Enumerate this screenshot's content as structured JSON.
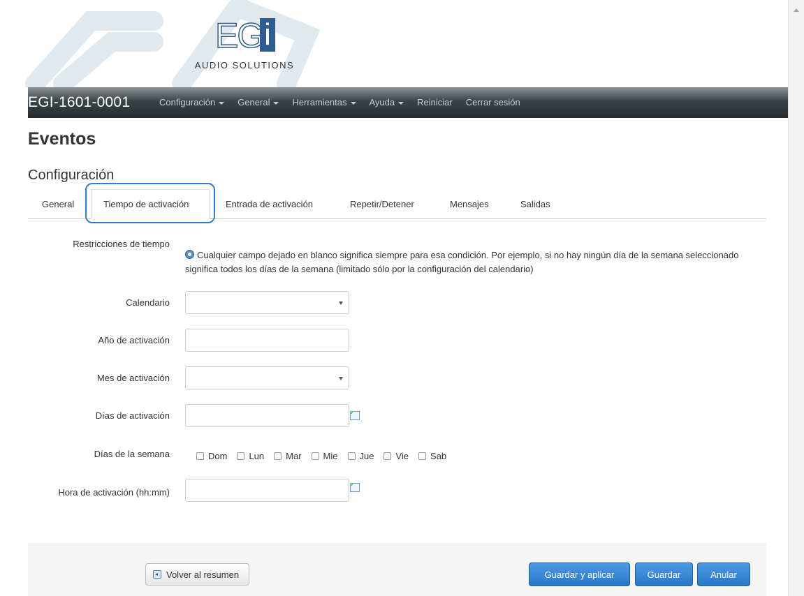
{
  "header": {
    "logo_main": "EG",
    "logo_letter": "i",
    "logo_sub": "AUDIO SOLUTIONS"
  },
  "navbar": {
    "brand": "EGI-1601-0001",
    "items": [
      {
        "label": "Configuración",
        "dropdown": true
      },
      {
        "label": "General",
        "dropdown": true
      },
      {
        "label": "Herramientas",
        "dropdown": true
      },
      {
        "label": "Ayuda",
        "dropdown": true
      },
      {
        "label": "Reiniciar",
        "dropdown": false
      },
      {
        "label": "Cerrar sesión",
        "dropdown": false
      }
    ]
  },
  "page": {
    "title": "Eventos",
    "section": "Configuración"
  },
  "tabs": [
    {
      "label": "General",
      "active": false
    },
    {
      "label": "Tiempo de activación",
      "active": true
    },
    {
      "label": "Entrada de activación",
      "active": false
    },
    {
      "label": "Repetir/Detener",
      "active": false
    },
    {
      "label": "Mensajes",
      "active": false
    },
    {
      "label": "Salidas",
      "active": false
    }
  ],
  "form": {
    "restrictions_label": "Restricciones de tiempo",
    "restrictions_hint": "Cualquier campo dejado en blanco significa siempre para esa condición. Por ejemplo, si no hay ningún día de la semana seleccionado significa todos los días de la semana (limitado sólo por la configuración del calendario)",
    "calendar_label": "Calendario",
    "calendar_value": "",
    "year_label": "Año de activación",
    "year_value": "",
    "month_label": "Mes de activación",
    "month_value": "",
    "days_label": "Días de activación",
    "days_value": "",
    "weekdays_label": "Días de la semana",
    "weekdays": [
      "Dom",
      "Lun",
      "Mar",
      "Mie",
      "Jue",
      "Vie",
      "Sab"
    ],
    "time_label": "Hora de activación (hh:mm)",
    "time_value": ""
  },
  "footer": {
    "back_label": "Volver al resumen",
    "save_apply_label": "Guardar y aplicar",
    "save_label": "Guardar",
    "cancel_label": "Anular"
  },
  "colors": {
    "accent": "#2a78c7",
    "highlight": "#2a7fd4",
    "navbar": "#2f3539"
  }
}
